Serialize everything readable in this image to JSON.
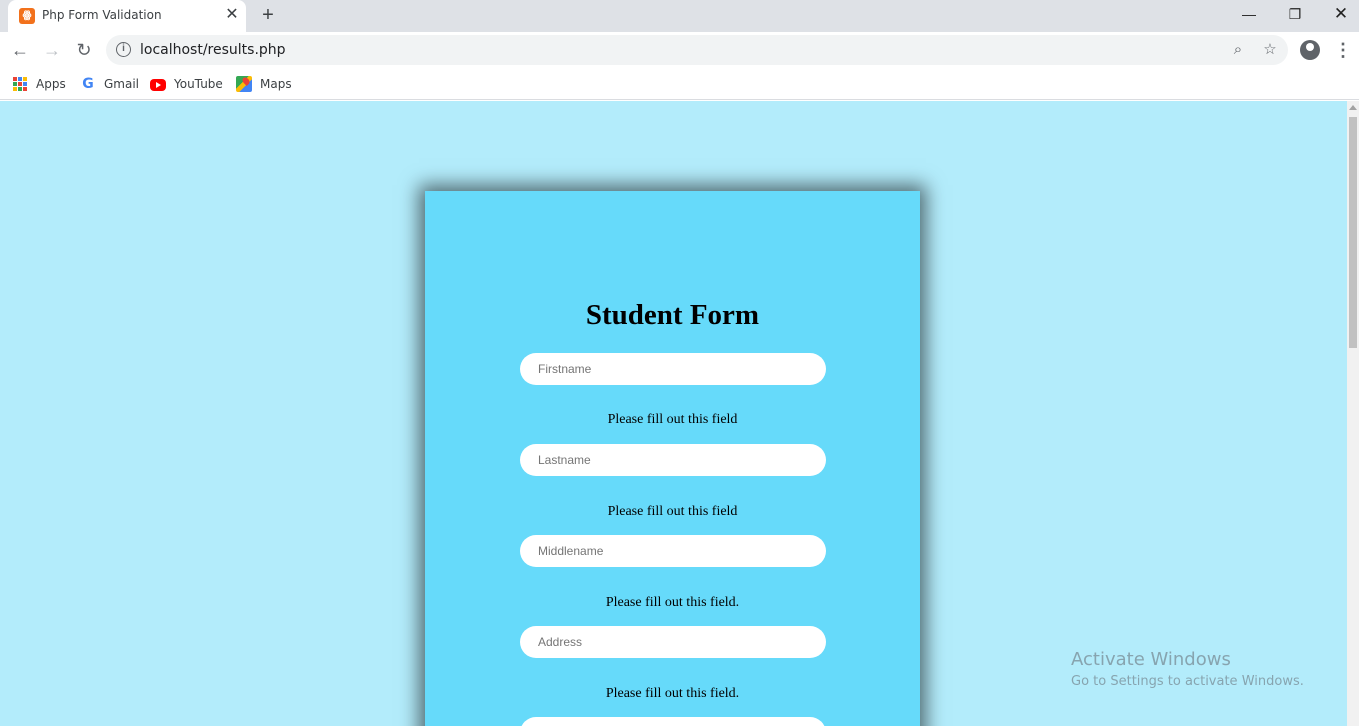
{
  "browser": {
    "tab_title": "Php Form Validation",
    "tab_favicon": "xampp-icon",
    "url": "localhost/results.php",
    "bookmarks": [
      {
        "label": "Apps",
        "icon": "apps-grid-icon"
      },
      {
        "label": "Gmail",
        "icon": "google-icon"
      },
      {
        "label": "YouTube",
        "icon": "youtube-icon"
      },
      {
        "label": "Maps",
        "icon": "maps-icon"
      }
    ]
  },
  "form": {
    "title": "Student Form",
    "fields": [
      {
        "placeholder": "Firstname",
        "error": "Please fill out this field"
      },
      {
        "placeholder": "Lastname",
        "error": "Please fill out this field"
      },
      {
        "placeholder": "Middlename",
        "error": "Please fill out this field."
      },
      {
        "placeholder": "Address",
        "error": "Please fill out this field."
      }
    ]
  },
  "watermark": {
    "title": "Activate Windows",
    "subtitle": "Go to Settings to activate Windows."
  },
  "colors": {
    "page_bg": "#b3ecfb",
    "card_bg": "#66dafa"
  }
}
